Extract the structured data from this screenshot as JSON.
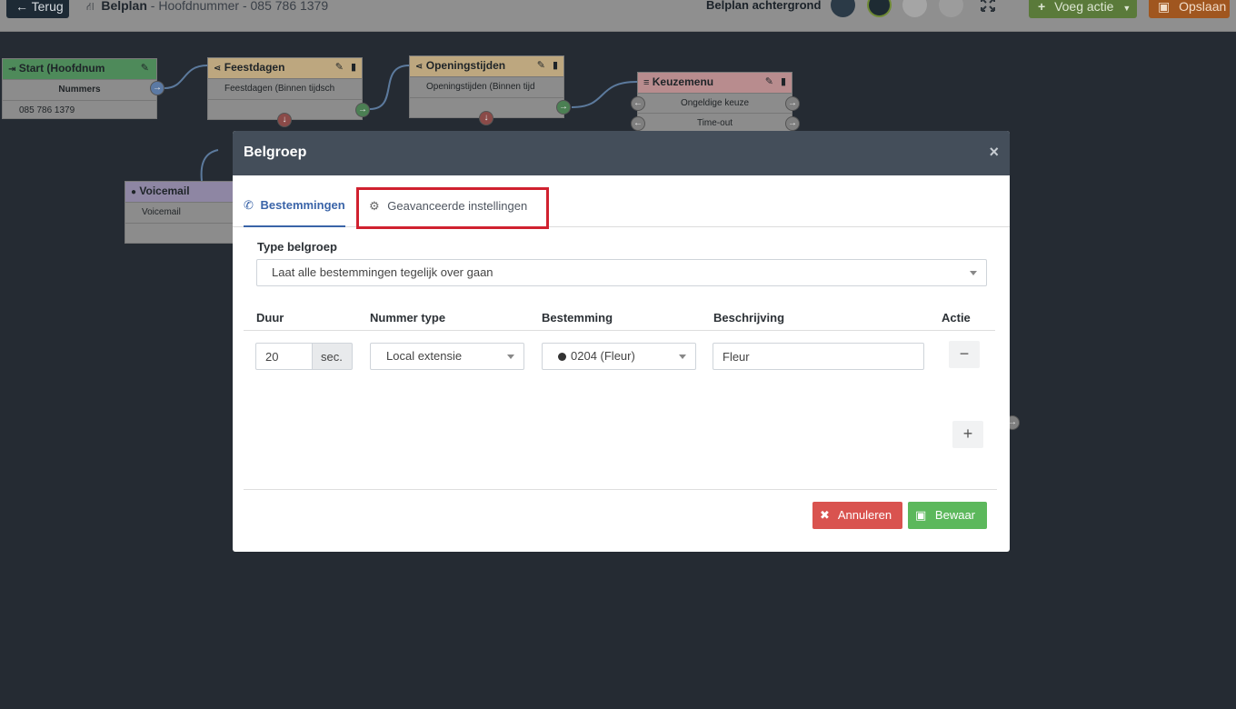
{
  "topbar": {
    "back_label": "Terug",
    "plan_label": "Belplan",
    "plan_subtitle": " - Hoofdnummer - 085 786 1379",
    "background_label": "Belplan achtergrond",
    "swatches": [
      "#2b3a47",
      "#1e2b33",
      "#a5a5a5",
      "#d8d8d8"
    ],
    "add_action_label": "Voeg actie",
    "save_label": "Opslaan"
  },
  "flow": {
    "start": {
      "title": "Start (Hoofdnum",
      "header_row": "Nummers",
      "number": "085 786 1379",
      "color": "#4e8a5a"
    },
    "holidays": {
      "title": "Feestdagen",
      "row": "Feestdagen (Binnen tijdsch",
      "color": "#bda77f"
    },
    "hours": {
      "title": "Openingstijden",
      "row": "Openingstijden (Binnen tijd",
      "color": "#bda77f"
    },
    "menu": {
      "title": "Keuzemenu",
      "rows": [
        "Ongeldige keuze",
        "Time-out"
      ],
      "color": "#b88c8e"
    },
    "voicemail": {
      "title": "Voicemail",
      "row": "Voicemail",
      "color": "#8e86a3"
    }
  },
  "modal": {
    "title": "Belgroep",
    "close_label": "×",
    "tabs": [
      {
        "label": "Bestemmingen",
        "icon": "phone-icon",
        "active": true
      },
      {
        "label": "Geavanceerde instellingen",
        "icon": "gear-icon",
        "active": false
      }
    ],
    "type_label": "Type belgroep",
    "type_value": "Laat alle bestemmingen tegelijk over gaan",
    "columns": [
      "Duur",
      "Nummer type",
      "Bestemming",
      "Beschrijving",
      "Actie"
    ],
    "row": {
      "duration": "20",
      "duration_unit": "sec.",
      "number_type": "Local extensie",
      "destination": "0204 (Fleur)",
      "description": "Fleur"
    },
    "remove_label": "−",
    "add_label": "+",
    "cancel_label": "Annuleren",
    "save_label": "Bewaar"
  }
}
